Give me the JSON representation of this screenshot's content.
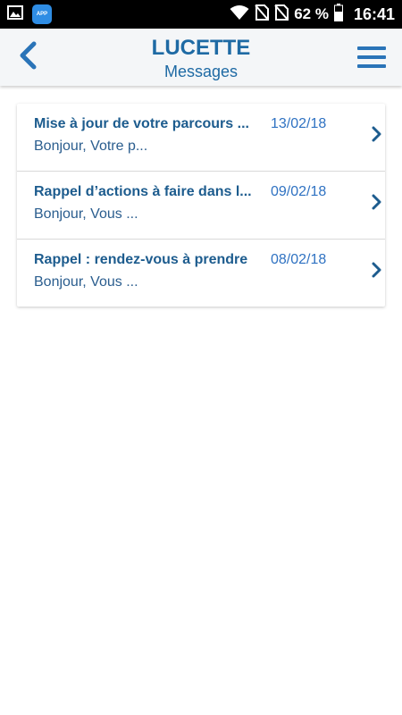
{
  "status_bar": {
    "app_badge_label": "APP",
    "battery": "62 %",
    "time": "16:41",
    "icons": [
      "image-icon",
      "app-icon",
      "wifi-icon",
      "no-sim-icon",
      "no-sim-icon",
      "battery-icon"
    ]
  },
  "header": {
    "title": "LUCETTE",
    "subtitle": "Messages",
    "back_icon": "chevron-left-icon",
    "menu_icon": "hamburger-menu-icon"
  },
  "messages": [
    {
      "title": "Mise à jour de votre parcours ...",
      "date": "13/02/18",
      "preview": "Bonjour, Votre p..."
    },
    {
      "title": "Rappel d’actions à faire dans l...",
      "date": "09/02/18",
      "preview": "Bonjour, Vous ..."
    },
    {
      "title": "Rappel : rendez-vous à prendre",
      "date": "08/02/18",
      "preview": "Bonjour, Vous ..."
    }
  ],
  "colors": {
    "brand_blue": "#1e6aa4",
    "date_blue": "#2f72c2",
    "header_bg": "#f4f6f8"
  }
}
